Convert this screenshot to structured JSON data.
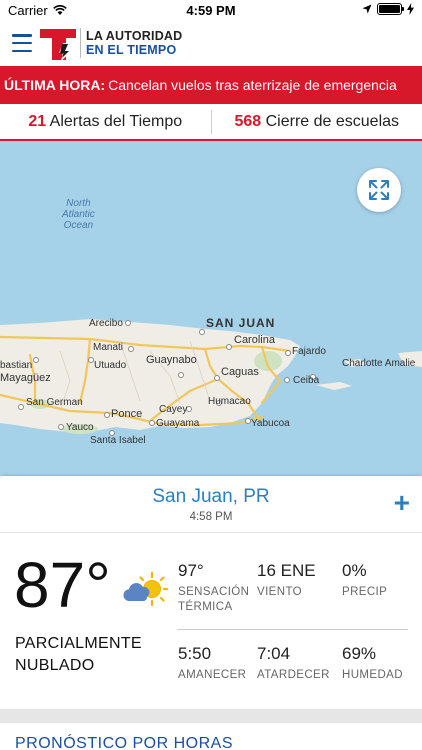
{
  "status_bar": {
    "carrier": "Carrier",
    "time": "4:59 PM"
  },
  "header": {
    "brand_line1": "LA AUTORIDAD",
    "brand_line2": "EN EL TIEMPO"
  },
  "breaking": {
    "tag": "ÚLTIMA HORA:",
    "text": "Cancelan vuelos tras aterrizaje de emergencia"
  },
  "alerts": [
    {
      "count": "21",
      "label": "Alertas del Tiempo"
    },
    {
      "count": "568",
      "label": "Cierre de escuelas"
    }
  ],
  "map": {
    "ocean_label": "North Atlantic Ocean",
    "ocean_l1": "North",
    "ocean_l2": "Atlantic",
    "ocean_l3": "Ocean",
    "places": {
      "san_juan": "SAN JUAN",
      "arecibo": "Arecibo",
      "manati": "Manati",
      "carolina": "Carolina",
      "fajardo": "Fajardo",
      "guaynabo": "Guaynabo",
      "caguas": "Caguas",
      "ceiba": "Ceiba",
      "charlotte": "Charlotte Amalie",
      "sebastian": "bastian",
      "mayaguez": "Mayagüez",
      "utuado": "Utuado",
      "san_german": "San German",
      "ponce": "Ponce",
      "cayey": "Cayey",
      "humacao": "Humacao",
      "yauco": "Yauco",
      "guayama": "Guayama",
      "yabucoa": "Yabucoa",
      "santa_isabel": "Santa Isabel"
    }
  },
  "location": {
    "city": "San Juan, PR",
    "time": "4:58 PM"
  },
  "current": {
    "temp": "87°",
    "condition_l1": "PARCIALMENTE",
    "condition_l2": "NUBLADO",
    "icon": "partly-cloudy-icon",
    "stats": {
      "feels": {
        "value": "97°",
        "label_l1": "SENSACIÓN",
        "label_l2": "TÉRMICA"
      },
      "wind": {
        "value": "16 ENE",
        "label": "VIENTO"
      },
      "precip": {
        "value": "0%",
        "label": "PRECIP"
      },
      "sunrise": {
        "value": "5:50",
        "label": "AMANECER"
      },
      "sunset": {
        "value": "7:04",
        "label": "ATARDECER"
      },
      "humidity": {
        "value": "69%",
        "label": "HUMEDAD"
      }
    }
  },
  "hourly": {
    "title": "PRONÓSTICO POR HORAS"
  },
  "colors": {
    "brand_blue": "#1a4f9c",
    "alert_red": "#d7182a",
    "link_blue": "#2a7fc1",
    "water": "#a6d2e9",
    "land": "#efede6"
  }
}
